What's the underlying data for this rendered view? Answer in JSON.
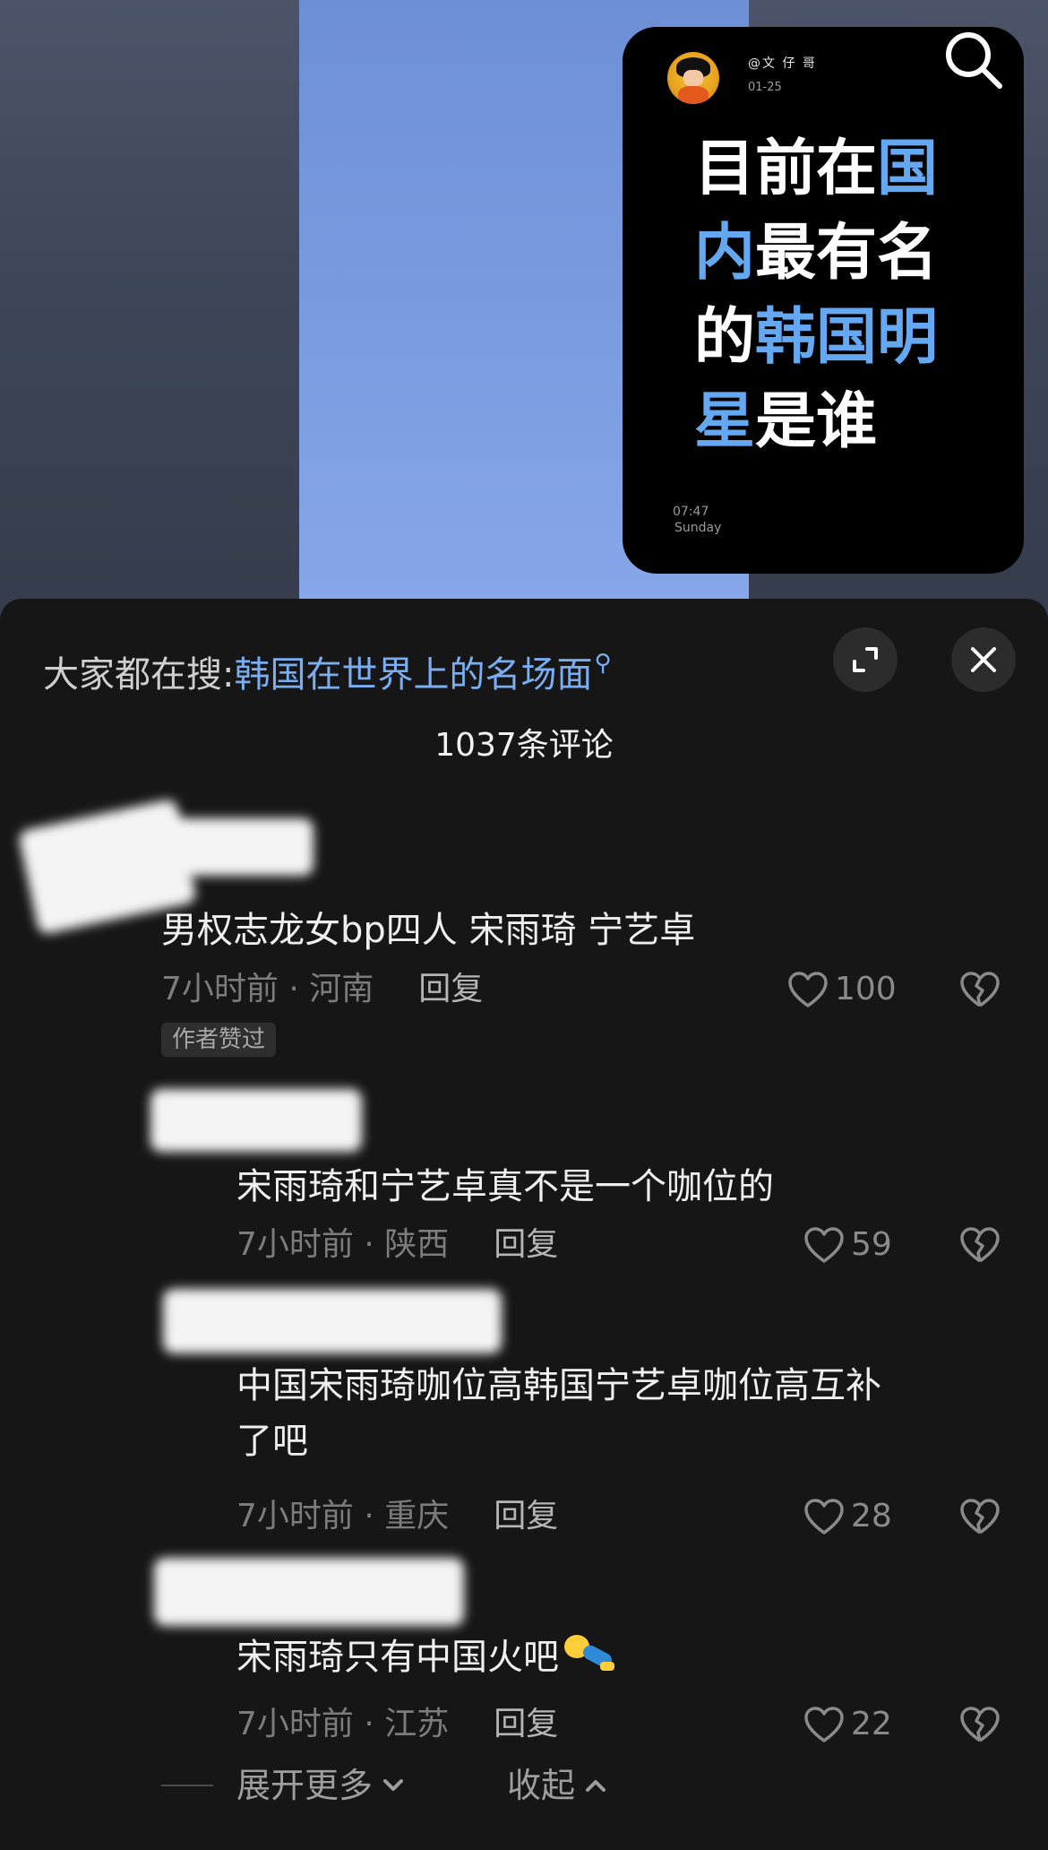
{
  "video": {
    "card": {
      "username": "@文 仔 哥",
      "date": "01-25",
      "title_parts": [
        {
          "text": "目前在",
          "highlight": false
        },
        {
          "text": "国内",
          "highlight": true
        },
        {
          "text": "最有名的",
          "highlight": false
        },
        {
          "text": "韩国明星",
          "highlight": true
        },
        {
          "text": "是谁",
          "highlight": false
        }
      ],
      "time": "07:47",
      "weekday": "Sunday"
    },
    "search_icon": "search-icon"
  },
  "sheet": {
    "hot_search_prefix": "大家都在搜:",
    "hot_search_term": "韩国在世界上的名场面",
    "comment_count": "1037条评论",
    "expand_icon": "expand-icon",
    "close_icon": "close-icon"
  },
  "comments": [
    {
      "text": "男权志龙女bp四人 宋雨琦 宁艺卓",
      "time": "7小时前 · 河南",
      "reply": "回复",
      "likes": "100",
      "author_badge": "作者赞过"
    },
    {
      "text": "宋雨琦和宁艺卓真不是一个咖位的",
      "time": "7小时前 · 陕西",
      "reply": "回复",
      "likes": "59"
    },
    {
      "text_line1": "中国宋雨琦咖位高韩国宁艺卓咖位高互补",
      "text_line2": "了吧",
      "time": "7小时前 · 重庆",
      "reply": "回复",
      "likes": "28"
    },
    {
      "text": "宋雨琦只有中国火吧",
      "time": "7小时前 · 江苏",
      "reply": "回复",
      "likes": "22"
    }
  ],
  "footer": {
    "expand_more": "展开更多",
    "collapse": "收起"
  },
  "colors": {
    "accent": "#64a8f2",
    "link": "#7aaef0",
    "background": "#161616"
  }
}
